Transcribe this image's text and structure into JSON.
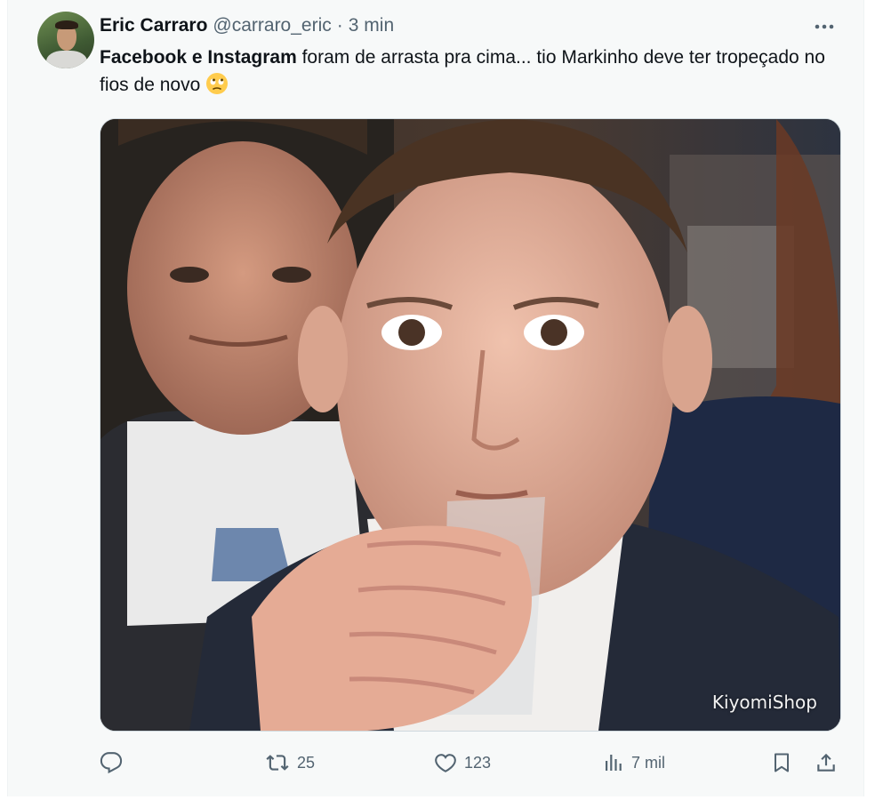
{
  "tweet": {
    "author_name": "Eric Carraro",
    "handle": "@carraro_eric",
    "separator": "·",
    "time": "3 min",
    "text_bold": "Facebook e Instagram",
    "text_rest": " foram de arrasta pra cima... tio Markinho deve ter tropeçado no fios de novo",
    "emoji": "eye-roll-emoji",
    "media": {
      "watermark": "KiyomiShop"
    },
    "actions": {
      "reply_count": "",
      "retweet_count": "25",
      "like_count": "123",
      "views_count": "7 mil"
    }
  },
  "colors": {
    "text": "#0f1419",
    "muted": "#536471",
    "background": "#f7f9f9"
  }
}
